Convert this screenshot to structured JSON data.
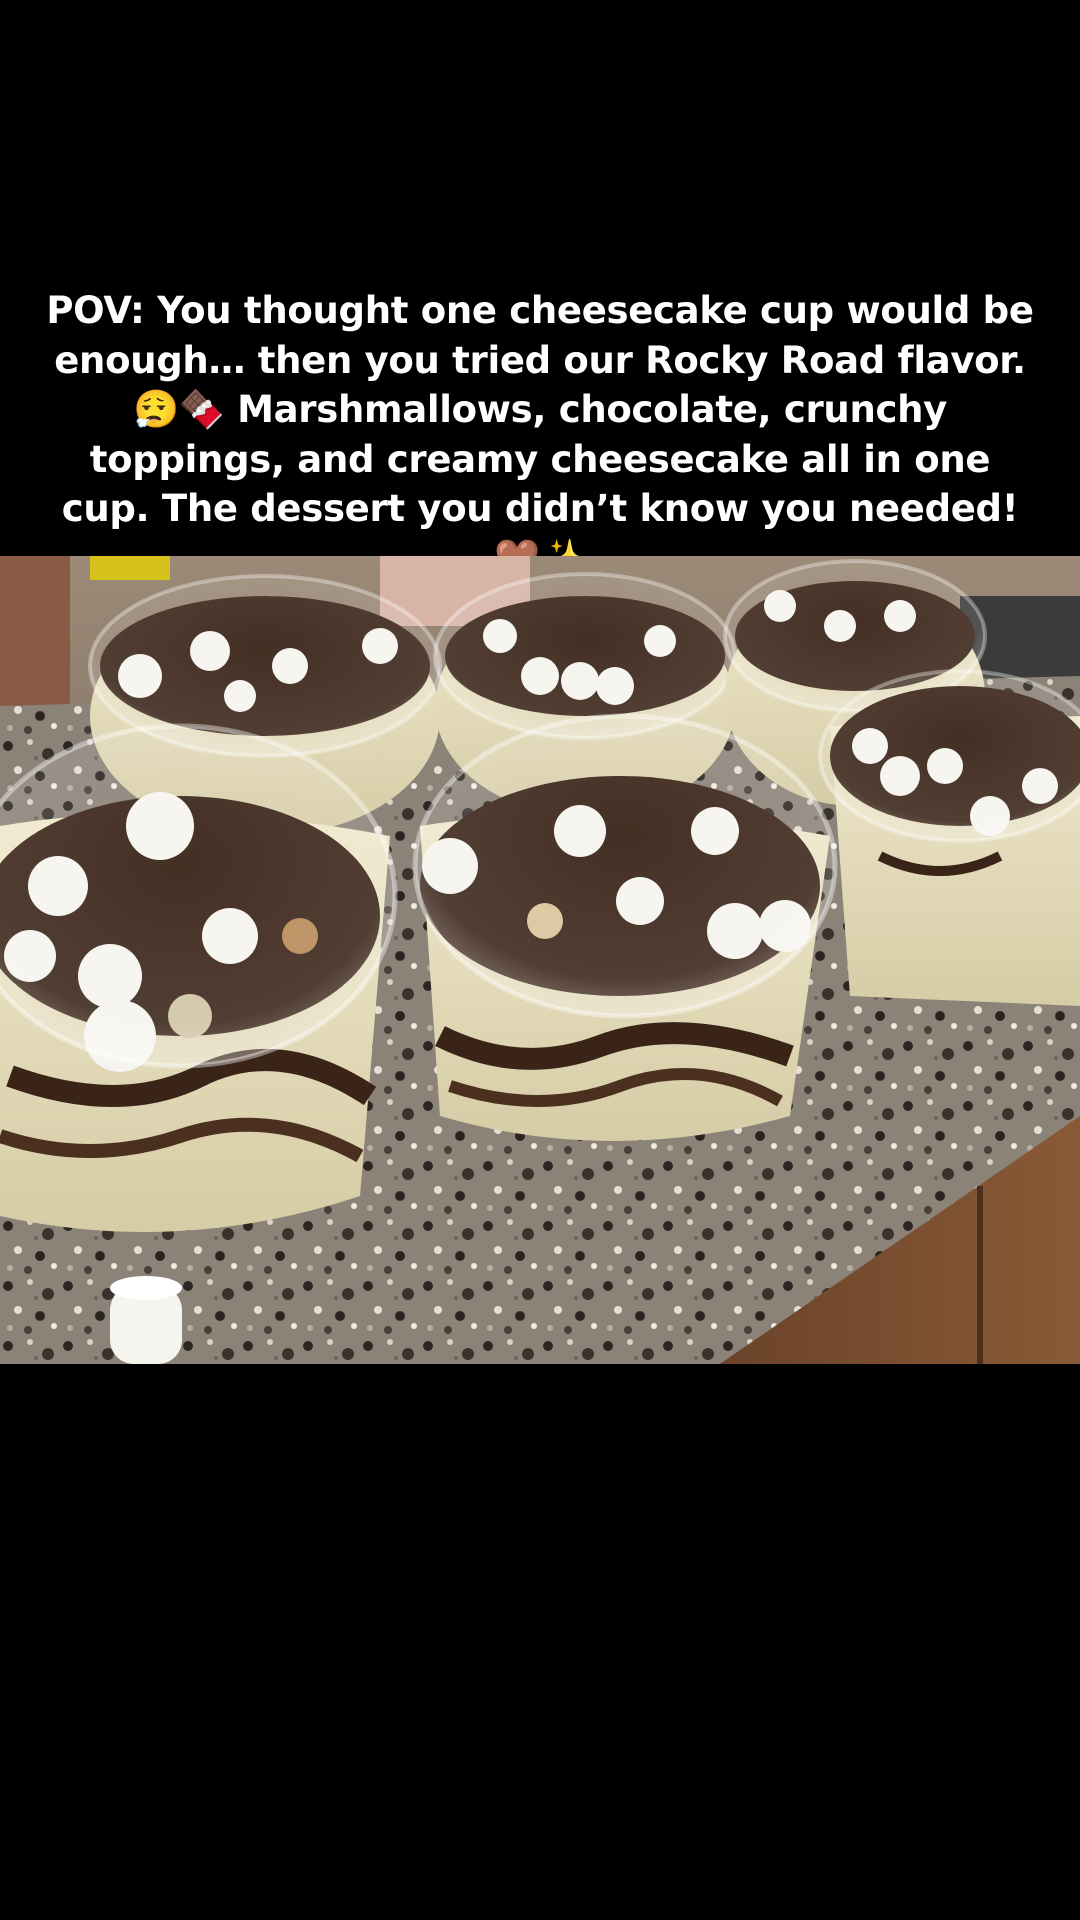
{
  "post": {
    "caption": "POV: You thought one cheesecake cup would be enough… then you tried our Rocky Road flavor. 😮‍💨🍫 Marshmallows, chocolate, crunchy toppings, and creamy cheesecake all in one cup. The dessert you didn’t know you needed! 🤎✨"
  },
  "photo": {
    "subject": "rocky-road-cheesecake-cups",
    "cup_count": 6
  },
  "colors": {
    "background": "#000000",
    "caption_text": "#ffffff",
    "granite": "#8a8076",
    "cheesecake": "#e9e2c4",
    "chocolate": "#3a2418",
    "marshmallow": "#f6f4ee",
    "cabinet": "#7a5132"
  }
}
